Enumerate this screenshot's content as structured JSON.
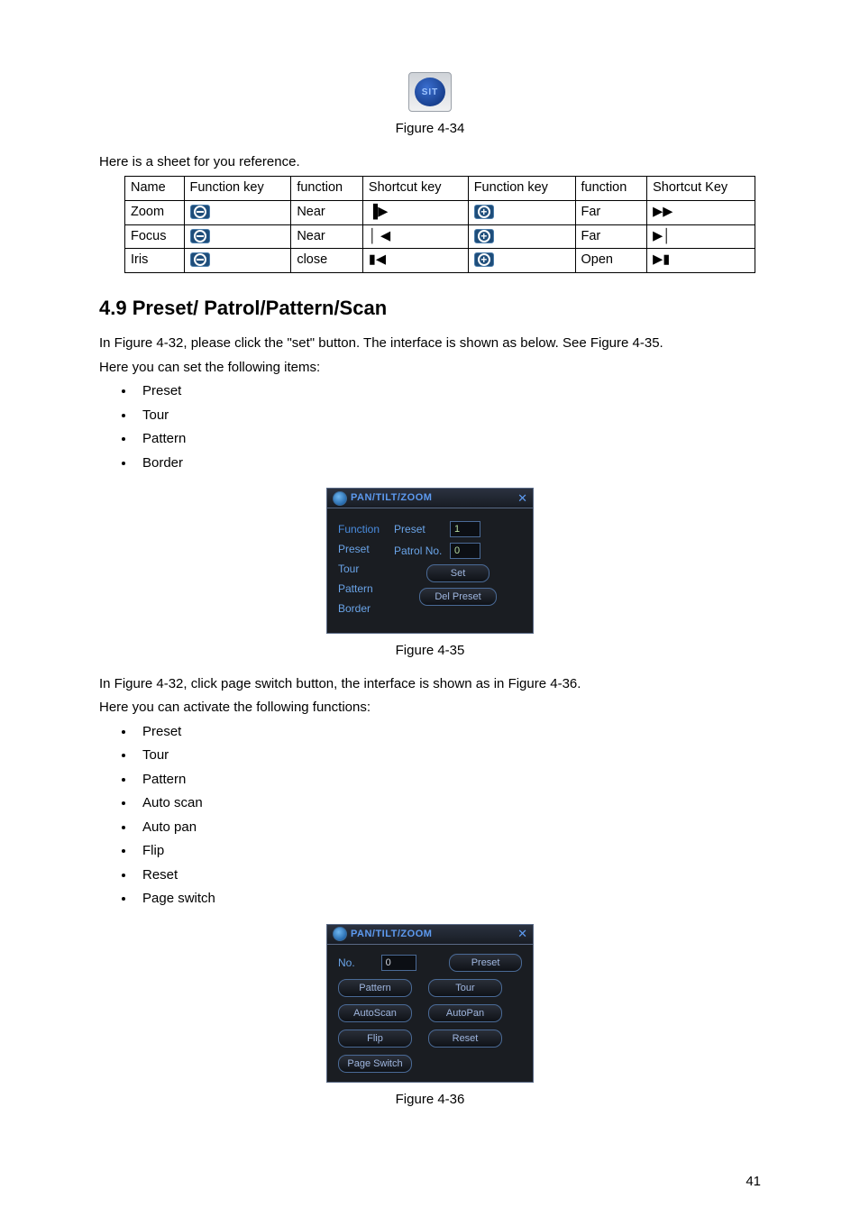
{
  "sit_icon_label": "SIT",
  "fig34": "Figure 4-34",
  "ref_intro": "Here is a sheet for you reference.",
  "table": {
    "headers": [
      "Name",
      "Function key",
      "function",
      "Shortcut key",
      "Function key",
      "function",
      "Shortcut Key"
    ],
    "rows": [
      {
        "name": "Zoom",
        "fn1_icon": "minus",
        "fn1_text": "Near",
        "sk1": "▐▶",
        "fn2_icon": "plus",
        "fn2_text": "Far",
        "sk2": "▶▶"
      },
      {
        "name": "Focus",
        "fn1_icon": "minus",
        "fn1_text": "Near",
        "sk1": "│ ◀",
        "fn2_icon": "plus",
        "fn2_text": "Far",
        "sk2": "▶│"
      },
      {
        "name": "Iris",
        "fn1_icon": "minus",
        "fn1_text": "close",
        "sk1": "▮◀",
        "fn2_icon": "plus",
        "fn2_text": "Open",
        "sk2": "▶▮"
      }
    ]
  },
  "section_heading": "4.9  Preset/ Patrol/Pattern/Scan",
  "para1a": "In Figure 4-32, please click the \"set\" button. The interface is shown as below. See Figure 4-35.",
  "para1b": "Here you can set the following items:",
  "list1": [
    "Preset",
    "Tour",
    "Pattern",
    "Border"
  ],
  "ptz_a": {
    "title": "PAN/TILT/ZOOM",
    "func_header": "Function",
    "func_items": [
      "Preset",
      "Tour",
      "Pattern",
      "Border"
    ],
    "preset_label": "Preset",
    "preset_value": "1",
    "patrol_label": "Patrol No.",
    "patrol_value": "0",
    "set_btn": "Set",
    "del_btn": "Del Preset"
  },
  "fig35": "Figure 4-35",
  "para2a": "In Figure 4-32, click page switch button, the interface is shown as in Figure 4-36.",
  "para2b": "Here you can activate the following functions:",
  "list2": [
    "Preset",
    "Tour",
    "Pattern",
    "Auto scan",
    "Auto pan",
    "Flip",
    "Reset",
    "Page switch"
  ],
  "ptz_b": {
    "title": "PAN/TILT/ZOOM",
    "no_label": "No.",
    "no_value": "0",
    "buttons": [
      "Preset",
      "Pattern",
      "Tour",
      "AutoScan",
      "AutoPan",
      "Flip",
      "Reset",
      "Page Switch"
    ]
  },
  "fig36": "Figure 4-36",
  "page_number": "41"
}
